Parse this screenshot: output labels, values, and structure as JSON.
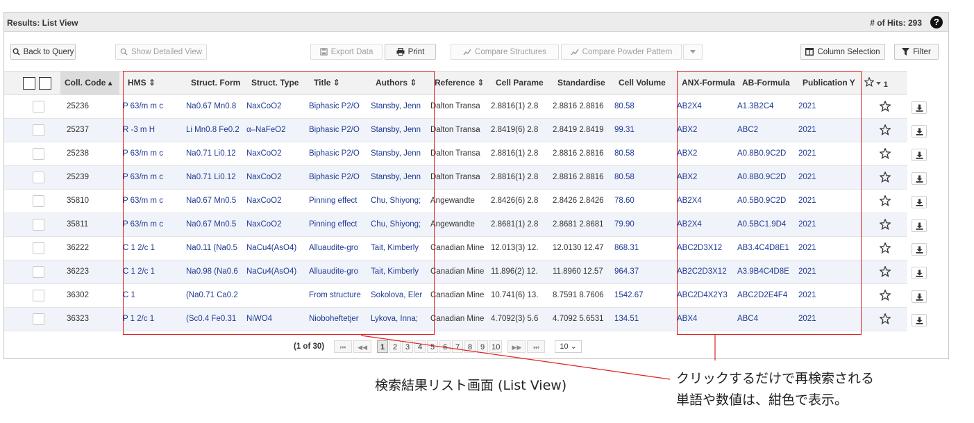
{
  "titlebar": {
    "title": "Results: List View",
    "hits": "# of Hits: 293",
    "help": "?"
  },
  "toolbar": {
    "back": "Back to Query",
    "detail": "Show Detailed View",
    "export": "Export Data",
    "print": "Print",
    "compare_structures": "Compare Structures",
    "compare_powder": "Compare Powder Pattern",
    "column_selection": "Column Selection",
    "filter": "Filter"
  },
  "headers": {
    "coll": "Coll. Code ▴",
    "hms": "HMS ⇕",
    "sform": "Struct. Form",
    "stype": "Struct. Type",
    "title": "Title ⇕",
    "authors": "Authors ⇕",
    "ref": "Reference ⇕",
    "cell": "Cell Parame",
    "std": "Standardise",
    "vol": "Cell Volume",
    "anx": "ANX-Formula",
    "ab": "AB-Formula",
    "pub": "Publication Y",
    "fav_count": "1"
  },
  "rows": [
    {
      "code": "25236",
      "hms": "P 63/m m c",
      "sform": "Na0.67 Mn0.8",
      "stype": "NaxCoO2",
      "title": "Biphasic P2/O",
      "authors": "Stansby, Jenn",
      "ref": "Dalton Transa",
      "cell": "2.8816(1) 2.8",
      "std": "2.8816 2.8816",
      "vol": "80.58",
      "anx": "AB2X4",
      "ab": "A1.3B2C4",
      "pub": "2021"
    },
    {
      "code": "25237",
      "hms": "R -3 m H",
      "sform": "Li Mn0.8 Fe0.2",
      "stype": "α–NaFeO2",
      "title": "Biphasic P2/O",
      "authors": "Stansby, Jenn",
      "ref": "Dalton Transa",
      "cell": "2.8419(6) 2.8",
      "std": "2.8419 2.8419",
      "vol": "99.31",
      "anx": "ABX2",
      "ab": "ABC2",
      "pub": "2021"
    },
    {
      "code": "25238",
      "hms": "P 63/m m c",
      "sform": "Na0.71 Li0.12",
      "stype": "NaxCoO2",
      "title": "Biphasic P2/O",
      "authors": "Stansby, Jenn",
      "ref": "Dalton Transa",
      "cell": "2.8816(1) 2.8",
      "std": "2.8816 2.8816",
      "vol": "80.58",
      "anx": "ABX2",
      "ab": "A0.8B0.9C2D",
      "pub": "2021"
    },
    {
      "code": "25239",
      "hms": "P 63/m m c",
      "sform": "Na0.71 Li0.12",
      "stype": "NaxCoO2",
      "title": "Biphasic P2/O",
      "authors": "Stansby, Jenn",
      "ref": "Dalton Transa",
      "cell": "2.8816(1) 2.8",
      "std": "2.8816 2.8816",
      "vol": "80.58",
      "anx": "ABX2",
      "ab": "A0.8B0.9C2D",
      "pub": "2021"
    },
    {
      "code": "35810",
      "hms": "P 63/m m c",
      "sform": "Na0.67 Mn0.5",
      "stype": "NaxCoO2",
      "title": "Pinning effect",
      "authors": "Chu, Shiyong;",
      "ref": "Angewandte",
      "cell": "2.8426(6) 2.8",
      "std": "2.8426 2.8426",
      "vol": "78.60",
      "anx": "AB2X4",
      "ab": "A0.5B0.9C2D",
      "pub": "2021"
    },
    {
      "code": "35811",
      "hms": "P 63/m m c",
      "sform": "Na0.67 Mn0.5",
      "stype": "NaxCoO2",
      "title": "Pinning effect",
      "authors": "Chu, Shiyong;",
      "ref": "Angewandte",
      "cell": "2.8681(1) 2.8",
      "std": "2.8681 2.8681",
      "vol": "79.90",
      "anx": "AB2X4",
      "ab": "A0.5BC1.9D4",
      "pub": "2021"
    },
    {
      "code": "36222",
      "hms": "C 1 2/c 1",
      "sform": "Na0.11 (Na0.5",
      "stype": "NaCu4(AsO4)",
      "title": "Alluaudite-gro",
      "authors": "Tait, Kimberly",
      "ref": "Canadian Mine",
      "cell": "12.013(3) 12.",
      "std": "12.0130 12.47",
      "vol": "868.31",
      "anx": "ABC2D3X12",
      "ab": "AB3.4C4D8E1",
      "pub": "2021"
    },
    {
      "code": "36223",
      "hms": "C 1 2/c 1",
      "sform": "Na0.98 (Na0.6",
      "stype": "NaCu4(AsO4)",
      "title": "Alluaudite-gro",
      "authors": "Tait, Kimberly",
      "ref": "Canadian Mine",
      "cell": "11.896(2) 12.",
      "std": "11.8960 12.57",
      "vol": "964.37",
      "anx": "AB2C2D3X12",
      "ab": "A3.9B4C4D8E",
      "pub": "2021"
    },
    {
      "code": "36302",
      "hms": "C 1",
      "sform": "(Na0.71 Ca0.2",
      "stype": "",
      "title": "From structure",
      "authors": "Sokolova, Eler",
      "ref": "Canadian Mine",
      "cell": "10.741(6) 13.",
      "std": "8.7591 8.7606",
      "vol": "1542.67",
      "anx": "ABC2D4X2Y3",
      "ab": "ABC2D2E4F4",
      "pub": "2021"
    },
    {
      "code": "36323",
      "hms": "P 1 2/c 1",
      "sform": "(Sc0.4 Fe0.31",
      "stype": "NiWO4",
      "title": "Nioboheftetjer",
      "authors": "Lykova, Inna;",
      "ref": "Canadian Mine",
      "cell": "4.7092(3) 5.6",
      "std": "4.7092 5.6531",
      "vol": "134.51",
      "anx": "ABX4",
      "ab": "ABC4",
      "pub": "2021"
    }
  ],
  "pagination": {
    "info": "(1 of 30)",
    "first": "⏮",
    "prev": "◀◀",
    "next": "▶▶",
    "last": "⏭",
    "pages": [
      "1",
      "2",
      "3",
      "4",
      "5",
      "6",
      "7",
      "8",
      "9",
      "10"
    ],
    "per_page": "10 ⌄"
  },
  "annotations": {
    "left": "検索結果リスト画面 (List View)",
    "right_line1": "クリックするだけで再検索される",
    "right_line2": "単語や数値は、紺色で表示。"
  },
  "colors": {
    "link": "#1f3a93",
    "highlight_box": "#e02020",
    "alt_row": "#f0f4fa"
  }
}
